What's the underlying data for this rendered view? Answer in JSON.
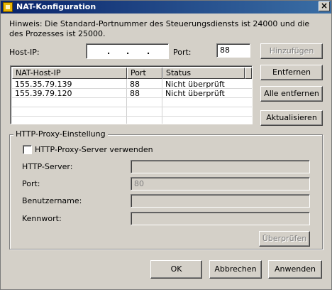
{
  "window": {
    "title": "NAT-Konfiguration",
    "close_glyph": "×"
  },
  "hint": "Hinweis: Die Standard-Portnummer des Steuerungsdiensts ist 24000 und die des Prozesses ist 25000.",
  "host": {
    "host_ip_label": "Host-IP:",
    "ip_dots": [
      ".",
      ".",
      "."
    ],
    "port_label": "Port:",
    "port_value": "88"
  },
  "buttons": {
    "add": "Hinzufügen",
    "remove": "Entfernen",
    "remove_all": "Alle entfernen",
    "refresh": "Aktualisieren",
    "check": "Überprüfen",
    "ok": "OK",
    "cancel": "Abbrechen",
    "apply": "Anwenden"
  },
  "table": {
    "columns": [
      "NAT-Host-IP",
      "Port",
      "Status"
    ],
    "rows": [
      {
        "ip": "155.35.79.139",
        "port": "88",
        "status": "Nicht überprüft"
      },
      {
        "ip": "155.39.79.120",
        "port": "88",
        "status": "Nicht überprüft"
      }
    ]
  },
  "proxy": {
    "group_title": "HTTP-Proxy-Einstellung",
    "use_proxy_label": "HTTP-Proxy-Server verwenden",
    "use_proxy_checked": false,
    "server_label": "HTTP-Server:",
    "server_value": "",
    "port_label": "Port:",
    "port_value": "80",
    "user_label": "Benutzername:",
    "user_value": "",
    "password_label": "Kennwort:",
    "password_value": ""
  }
}
